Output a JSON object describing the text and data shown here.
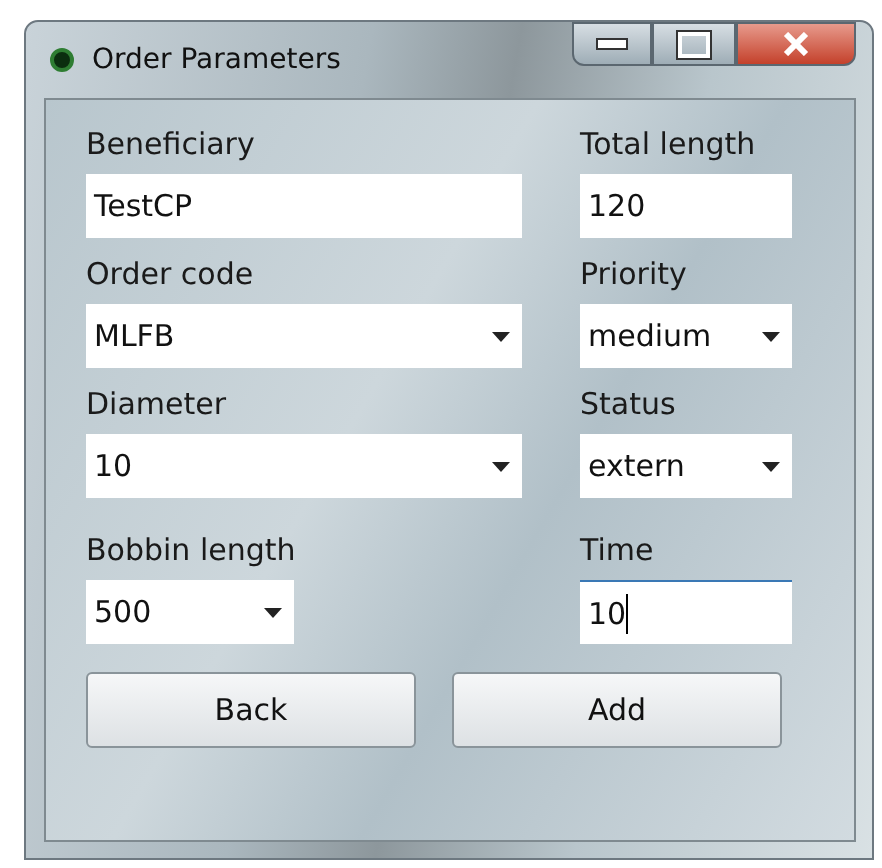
{
  "window": {
    "title": "Order Parameters"
  },
  "fields": [
    {
      "label": "Beneficiary",
      "value": "TestCP",
      "kind": "text",
      "focused": false
    },
    {
      "label": "Total length",
      "value": "120",
      "kind": "text",
      "focused": false
    },
    {
      "label": "Order code",
      "value": "MLFB",
      "kind": "dropdown",
      "focused": false
    },
    {
      "label": "Priority",
      "value": "medium",
      "kind": "dropdown",
      "focused": false
    },
    {
      "label": "Diameter",
      "value": "10",
      "kind": "dropdown",
      "focused": false
    },
    {
      "label": "Status",
      "value": "extern",
      "kind": "dropdown",
      "focused": false
    },
    {
      "label": "Bobbin length",
      "value": "500",
      "kind": "dropdown",
      "focused": false
    },
    {
      "label": "Time",
      "value": "10",
      "kind": "text",
      "focused": true
    }
  ],
  "buttons": [
    "Back",
    "Add"
  ]
}
